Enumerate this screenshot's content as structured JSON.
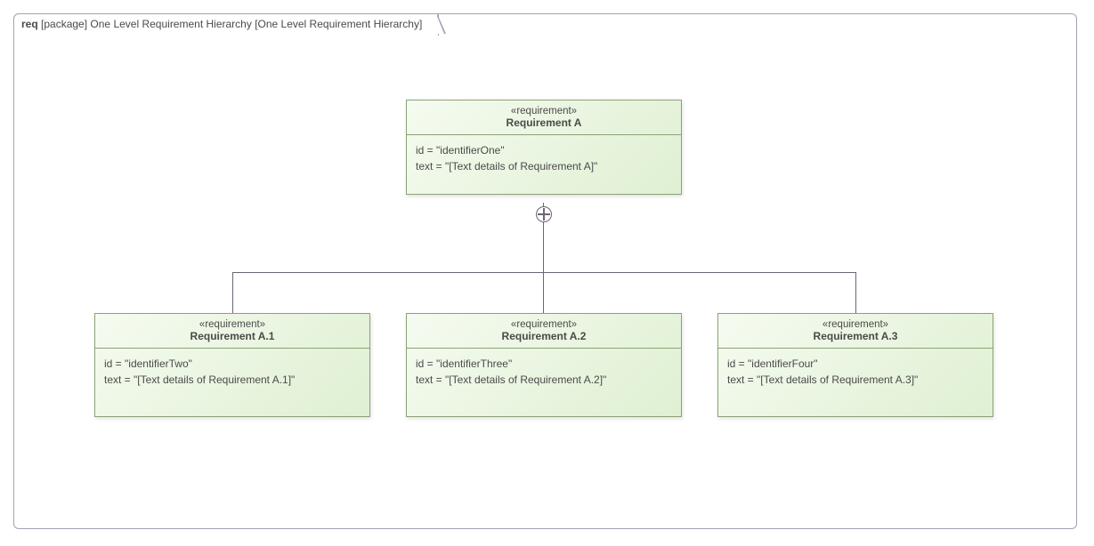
{
  "frame": {
    "kind": "req",
    "scope": "[package]",
    "title": "One Level Requirement Hierarchy",
    "bracket": "[One Level Requirement Hierarchy]"
  },
  "parent": {
    "stereotype": "«requirement»",
    "name": "Requirement A",
    "id_line": "id = \"identifierOne\"",
    "text_line": "text = \"[Text details of Requirement A]\""
  },
  "children": [
    {
      "stereotype": "«requirement»",
      "name": "Requirement A.1",
      "id_line": "id = \"identifierTwo\"",
      "text_line": "text = \"[Text details of Requirement A.1]\""
    },
    {
      "stereotype": "«requirement»",
      "name": "Requirement A.2",
      "id_line": "id = \"identifierThree\"",
      "text_line": "text = \"[Text details of Requirement A.2]\""
    },
    {
      "stereotype": "«requirement»",
      "name": "Requirement A.3",
      "id_line": "id = \"identifierFour\"",
      "text_line": "text = \"[Text details of Requirement A.3]\""
    }
  ]
}
